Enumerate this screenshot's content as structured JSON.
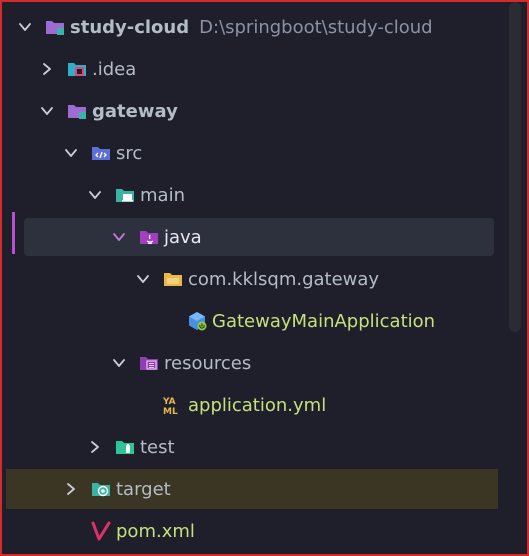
{
  "colors": {
    "background": "#1e1f2a",
    "border": "#d42a2a",
    "selection_bg": "#2d303d",
    "target_bg": "#3a3623",
    "folder_purple": "#9e6bd3",
    "folder_teal": "#3ab3a4",
    "folder_yellow": "#e8b84a",
    "highlight_text": "#c6e07d"
  },
  "tree": [
    {
      "key": "study-cloud",
      "label": "study-cloud",
      "path": "D:\\springboot\\study-cloud",
      "expanded": true,
      "icon": "module-folder-icon"
    },
    {
      "key": "idea",
      "label": ".idea",
      "expanded": false,
      "icon": "idea-folder-icon"
    },
    {
      "key": "gateway",
      "label": "gateway",
      "expanded": true,
      "icon": "module-folder-icon"
    },
    {
      "key": "src",
      "label": "src",
      "expanded": true,
      "icon": "source-folder-icon"
    },
    {
      "key": "main",
      "label": "main",
      "expanded": true,
      "icon": "main-folder-icon"
    },
    {
      "key": "java",
      "label": "java",
      "expanded": true,
      "icon": "java-folder-icon"
    },
    {
      "key": "package",
      "label": "com.kklsqm.gateway",
      "expanded": true,
      "icon": "package-folder-icon"
    },
    {
      "key": "gateway-main-app",
      "label": "GatewayMainApplication",
      "icon": "spring-boot-class-icon"
    },
    {
      "key": "resources",
      "label": "resources",
      "expanded": true,
      "icon": "resources-folder-icon"
    },
    {
      "key": "application-yml",
      "label": "application.yml",
      "icon": "yaml-file-icon"
    },
    {
      "key": "test",
      "label": "test",
      "expanded": false,
      "icon": "test-folder-icon"
    },
    {
      "key": "target",
      "label": "target",
      "expanded": false,
      "icon": "target-folder-icon"
    },
    {
      "key": "pom",
      "label": "pom.xml",
      "icon": "maven-file-icon"
    }
  ]
}
